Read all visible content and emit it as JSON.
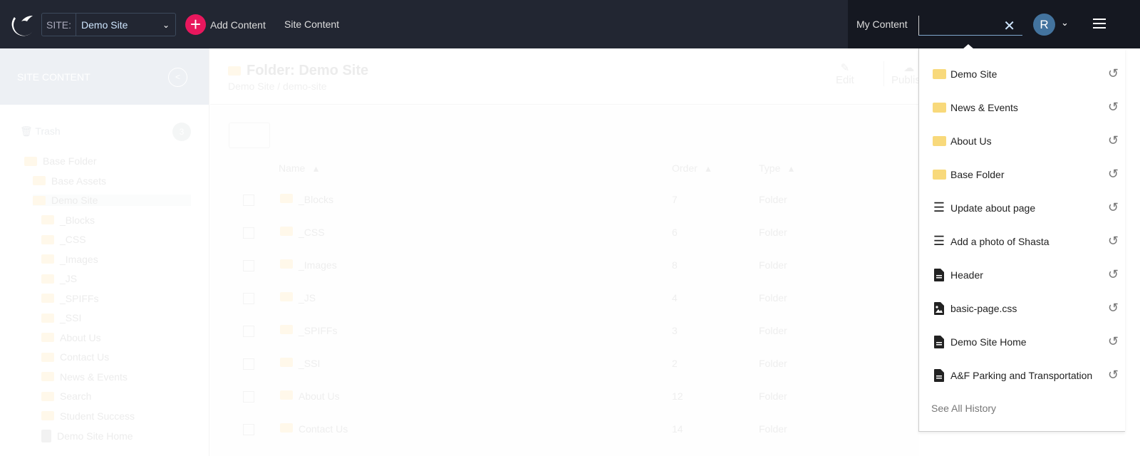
{
  "header": {
    "site_label": "SITE:",
    "site_value": "Demo Site",
    "add_content": "Add Content",
    "site_content": "Site Content",
    "my_content": "My Content",
    "search_value": "",
    "avatar_initial": "R",
    "colors": {
      "bar": "#222632",
      "accent": "#e8175d",
      "avatar": "#43739e"
    }
  },
  "sidebar": {
    "title": "SITE CONTENT",
    "trash": "Trash",
    "trash_count": "3",
    "tree": [
      {
        "label": "Base Folder"
      },
      {
        "label": "Base Assets"
      },
      {
        "label": "Demo Site"
      },
      {
        "label": "_Blocks"
      },
      {
        "label": "_CSS"
      },
      {
        "label": "_Images"
      },
      {
        "label": "_JS"
      },
      {
        "label": "_SPIFFs"
      },
      {
        "label": "_SSI"
      },
      {
        "label": "About Us"
      },
      {
        "label": "Contact Us"
      },
      {
        "label": "News & Events"
      },
      {
        "label": "Search"
      },
      {
        "label": "Student Success"
      },
      {
        "label": "Demo Site Home"
      }
    ]
  },
  "main": {
    "title": "Folder: Demo Site",
    "crumb_1": "Demo Site",
    "crumb_sep": "/",
    "crumb_2": "demo-site",
    "edit": "Edit",
    "publish": "Publish",
    "columns": {
      "name": "Name",
      "order": "Order",
      "type": "Type"
    },
    "rows": [
      {
        "name": "_Blocks",
        "order": "7",
        "type": "Folder"
      },
      {
        "name": "_CSS",
        "order": "6",
        "type": "Folder"
      },
      {
        "name": "_Images",
        "order": "8",
        "type": "Folder"
      },
      {
        "name": "_JS",
        "order": "4",
        "type": "Folder"
      },
      {
        "name": "_SPIFFs",
        "order": "3",
        "type": "Folder"
      },
      {
        "name": "_SSI",
        "order": "2",
        "type": "Folder"
      },
      {
        "name": "About Us",
        "order": "12",
        "type": "Folder"
      },
      {
        "name": "Contact Us",
        "order": "14",
        "type": "Folder"
      }
    ]
  },
  "dropdown": {
    "items": [
      {
        "label": "Demo Site",
        "icon": "folder-icon"
      },
      {
        "label": "News & Events",
        "icon": "folder-icon"
      },
      {
        "label": "About Us",
        "icon": "folder-icon"
      },
      {
        "label": "Base Folder",
        "icon": "folder-icon"
      },
      {
        "label": "Update about page",
        "icon": "list-icon"
      },
      {
        "label": "Add a photo of Shasta",
        "icon": "list-icon"
      },
      {
        "label": "Header",
        "icon": "document-icon"
      },
      {
        "label": "basic-page.css",
        "icon": "image-file-icon"
      },
      {
        "label": "Demo Site Home",
        "icon": "document-icon"
      },
      {
        "label": "A&F Parking and Transportation",
        "icon": "document-icon"
      }
    ],
    "see_all": "See All History"
  }
}
